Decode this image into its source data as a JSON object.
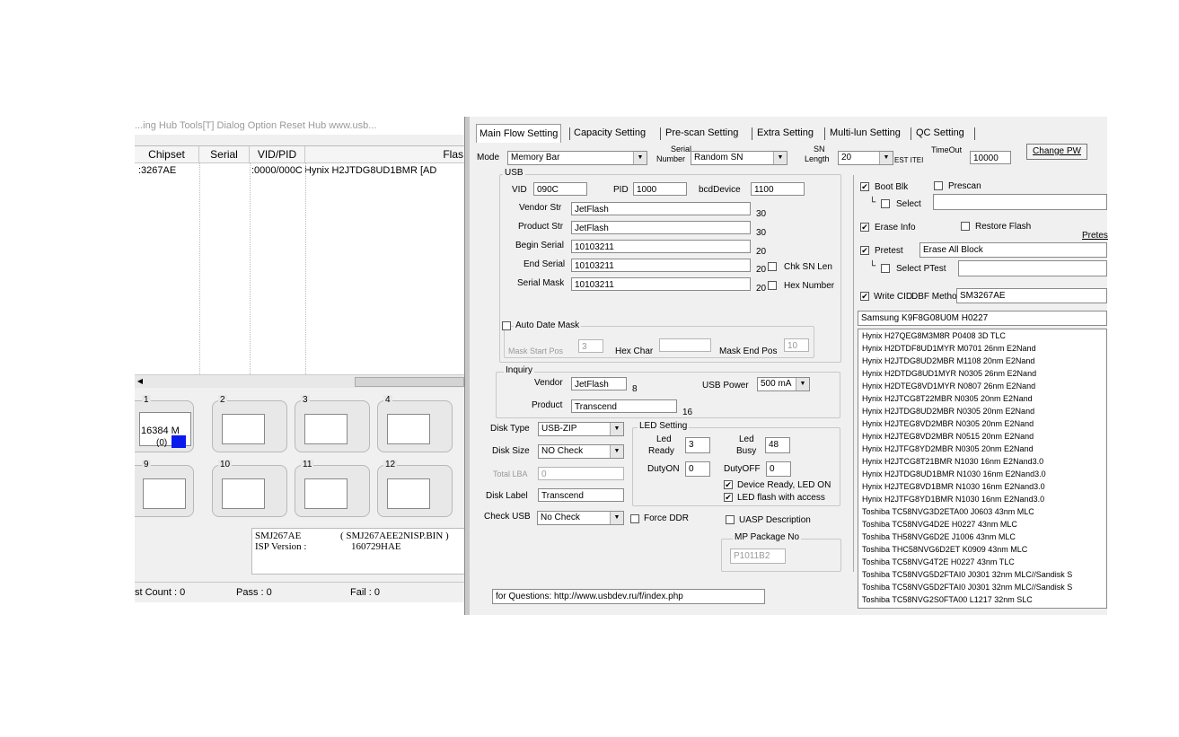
{
  "left_panel": {
    "menu_partial": "...ing Hub    Tools[T]    Dialog Option    Reset Hub    www.usb...",
    "columns": [
      "Chipset",
      "Serial",
      "VID/PID",
      "Flas"
    ],
    "row": {
      "chipset": ":3267AE",
      "serial": "",
      "vidpid": ":0000/000C",
      "flash": "Hynix H2JTDG8UD1BMR [AD"
    },
    "ports": [
      {
        "num": "1",
        "capacity": "16384 M",
        "sub": "(0)"
      },
      {
        "num": "2"
      },
      {
        "num": "3"
      },
      {
        "num": "4"
      },
      {
        "num": "9"
      },
      {
        "num": "10"
      },
      {
        "num": "11"
      },
      {
        "num": "12"
      }
    ],
    "info": {
      "line1_a": "SMJ267AE",
      "line1_b": "( SMJ267AEE2NISP.BIN )",
      "line2_a": "ISP Version :",
      "line2_b": "160729HAE"
    },
    "status": {
      "test_count": "st Count : 0",
      "pass": "Pass : 0",
      "fail": "Fail : 0"
    }
  },
  "tabs": [
    "Main Flow Setting",
    "Capacity Setting",
    "Pre-scan Setting",
    "Extra Setting",
    "Multi-lun Setting",
    "QC Setting"
  ],
  "top_row": {
    "mode_label": "Mode",
    "mode_value": "Memory Bar",
    "serial_label_1": "Serial",
    "serial_label_2": "Number",
    "serial_value": "Random SN",
    "sn_label_1": "SN",
    "sn_label_2": "Length",
    "sn_value": "20",
    "timeout_label": "TimeOut",
    "timeout_prefix": "EST ITEI",
    "timeout_value": "10000",
    "change_pw": "Change PW"
  },
  "usb": {
    "title": "USB",
    "vid_label": "VID",
    "vid": "090C",
    "pid_label": "PID",
    "pid": "1000",
    "bcd_label": "bcdDevice",
    "bcd": "1100",
    "vendor_str_label": "Vendor Str",
    "vendor_str": "JetFlash",
    "vendor_str_len": "30",
    "product_str_label": "Product Str",
    "product_str": "JetFlash",
    "product_str_len": "30",
    "begin_serial_label": "Begin Serial",
    "begin_serial": "10103211",
    "begin_serial_len": "20",
    "end_serial_label": "End Serial",
    "end_serial": "10103211",
    "end_serial_len": "20",
    "serial_mask_label": "Serial Mask",
    "serial_mask": "10103211",
    "serial_mask_len": "20",
    "chk_sn_len": "Chk SN Len",
    "hex_number": "Hex Number",
    "auto_date_mask": "Auto Date Mask",
    "mask_start_label": "Mask Start Pos",
    "mask_start": "3",
    "hex_char_label": "Hex Char",
    "hex_char": "",
    "mask_end_label": "Mask End Pos",
    "mask_end": "10"
  },
  "inquiry": {
    "title": "Inquiry",
    "vendor_label": "Vendor",
    "vendor": "JetFlash",
    "vendor_len": "8",
    "product_label": "Product",
    "product": "Transcend",
    "product_len": "16",
    "usb_power_label": "USB Power",
    "usb_power": "500 mA"
  },
  "disk": {
    "type_label": "Disk Type",
    "type": "USB-ZIP",
    "size_label": "Disk Size",
    "size": "NO Check",
    "lba_label": "Total LBA",
    "lba": "0",
    "label_label": "Disk Label",
    "label": "Transcend",
    "check_usb_label": "Check USB",
    "check_usb": "No Check",
    "force_ddr": "Force DDR"
  },
  "led": {
    "title": "LED Setting",
    "ready_label_1": "Led",
    "ready_label_2": "Ready",
    "ready": "3",
    "busy_label_1": "Led",
    "busy_label_2": "Busy",
    "busy": "48",
    "dutyon_label": "DutyON",
    "dutyon": "0",
    "dutyoff_label": "DutyOFF",
    "dutyoff": "0",
    "device_ready": "Device Ready, LED ON",
    "flash_access": "LED flash with access"
  },
  "uasp": "UASP Description",
  "mp_package": {
    "title": "MP Package No",
    "value": "P1011B2"
  },
  "questions": "for Questions: http://www.usbdev.ru/f/index.php",
  "right_options": {
    "boot_blk": "Boot Blk",
    "prescan": "Prescan",
    "select": "Select",
    "erase_info": "Erase Info",
    "restore_flash": "Restore Flash",
    "pretest_btn": "Pretes",
    "pretest": "Pretest",
    "pretest_value": "Erase All Block",
    "select_ptest": "Select PTest",
    "write_cid": "Write CID",
    "dbf_method_label": "DBF Method",
    "dbf_method": "SM3267AE",
    "flash_selected": "Samsung K9F8G08U0M H0227"
  },
  "flash_list": [
    "Hynix H27QEG8M3M8R P0408 3D TLC",
    "Hynix H2DTDF8UD1MYR M0701 26nm E2Nand",
    "Hynix H2JTDG8UD2MBR M1108 20nm E2Nand",
    "Hynix H2DTDG8UD1MYR N0305 26nm E2Nand",
    "Hynix H2DTEG8VD1MYR N0807 26nm E2Nand",
    "Hynix H2JTCG8T22MBR N0305 20nm E2Nand",
    "Hynix H2JTDG8UD2MBR N0305 20nm E2Nand",
    "Hynix H2JTEG8VD2MBR N0305 20nm E2Nand",
    "Hynix H2JTEG8VD2MBR N0515 20nm E2Nand",
    "Hynix H2JTFG8YD2MBR N0305 20nm E2Nand",
    "Hynix H2JTCG8T21BMR N1030 16nm E2Nand3.0",
    "Hynix H2JTDG8UD1BMR N1030 16nm E2Nand3.0",
    "Hynix H2JTEG8VD1BMR N1030 16nm E2Nand3.0",
    "Hynix H2JTFG8YD1BMR N1030 16nm E2Nand3.0",
    "Toshiba TC58NVG3D2ETA00 J0603 43nm MLC",
    "Toshiba TC58NVG4D2E H0227 43nm MLC",
    "Toshiba TH58NVG6D2E J1006 43nm MLC",
    "Toshiba THC58NVG6D2ET K0909 43nm MLC",
    "Toshiba TC58NVG4T2E H0227 43nm TLC",
    "Toshiba TC58NVG5D2FTAI0 J0301 32nm MLC//Sandisk S",
    "Toshiba TC58NVG5D2FTAI0 J0301 32nm MLC//Sandisk S",
    "Toshiba TC58NVG2S0FTA00 L1217 32nm SLC"
  ]
}
